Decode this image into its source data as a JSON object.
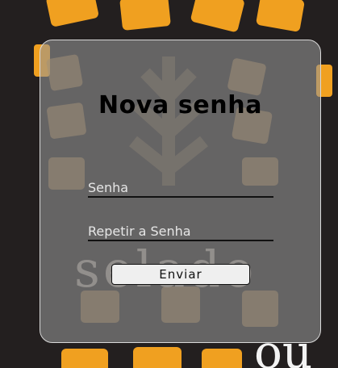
{
  "background": {
    "logo_text": "selado"
  },
  "form": {
    "title": "Nova senha",
    "password_placeholder": "Senha",
    "repeat_password_placeholder": "Repetir a Senha",
    "submit_label": "Enviar"
  },
  "colors": {
    "page_background": "#231f1f",
    "accent_orange": "#f0a020",
    "card_background": "rgba(150,150,150,0.58)",
    "card_border": "#d9d9d9"
  }
}
